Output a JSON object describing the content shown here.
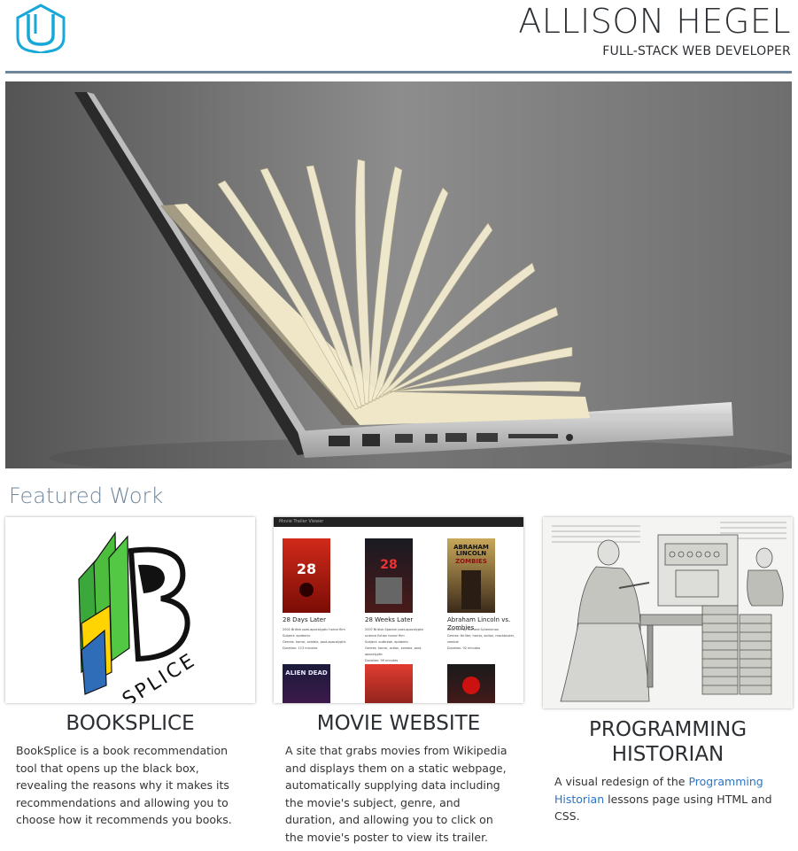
{
  "header": {
    "name": "ALLISON HEGEL",
    "subtitle": "FULL-STACK WEB DEVELOPER",
    "logo_icon": "udacity-logo-icon",
    "accent_color": "#6f8599",
    "logo_color": "#17a8d8"
  },
  "hero": {
    "icon": "laptop-book-photo"
  },
  "section": {
    "title": "Featured Work"
  },
  "cards": [
    {
      "title": "BOOKSPLICE",
      "description": "BookSplice is a book recommendation tool that opens up the black box, revealing the reasons why it makes its recommendations and allowing you to choose how it recommends you books.",
      "logo_text": "SPLICE"
    },
    {
      "title": "MOVIE WEBSITE",
      "description": "A site that grabs movies from Wikipedia and displays them on a static webpage, automatically supplying data including the movie's subject, genre, and duration, and allowing you to click on the movie's poster to view its trailer.",
      "thumb": {
        "bar": "Movie Trailer Viewer",
        "movies": [
          {
            "title": "28 Days Later",
            "line1": "2002 British post-apocalyptic horror film",
            "subject": "Subject: epidemic",
            "genres": "Genres: horror, zombie, post-apocalyptic",
            "duration": "Duration: 113 minutes",
            "poster_label": "28\nDAYS\nLATER"
          },
          {
            "title": "28 Weeks Later",
            "line1": "2007 British-Spanish post-apocalyptic science fiction horror film",
            "subject": "Subject: outbreak, epidemic",
            "genres": "Genres: horror, action, zombie, post-apocalyptic",
            "duration": "Duration: 99 minutes",
            "poster_label": "28\nWEEKS\nLATER"
          },
          {
            "title": "Abraham Lincoln vs. Zombies",
            "line1": "2012 film by Richard Schenkman",
            "subject": "",
            "genres": "Genres: thriller, horror, action, mockbuster, zombie",
            "duration": "Duration: 92 minutes",
            "poster_label": "ABRAHAM\nLINCOLN\nZOMBIES"
          }
        ],
        "row2": [
          "ALIEN DEAD",
          "",
          ""
        ]
      }
    },
    {
      "title": "PROGRAMMING HISTORIAN",
      "description_before": "A visual redesign of the ",
      "description_link": "Programming Historian",
      "description_after": " lessons page using HTML and CSS."
    }
  ]
}
